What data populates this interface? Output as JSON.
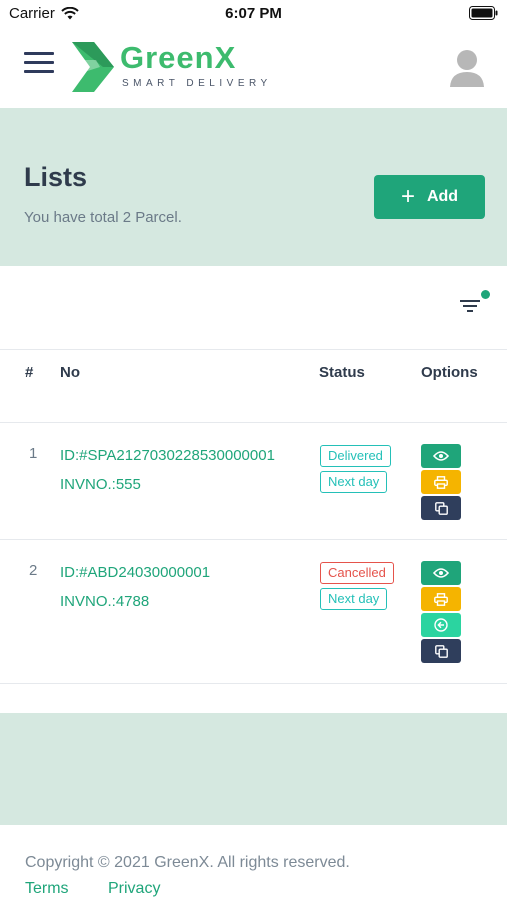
{
  "status_bar": {
    "carrier": "Carrier",
    "time": "6:07 PM"
  },
  "header": {
    "brand": "GreenX",
    "tagline": "SMART DELIVERY",
    "menu_icon": "hamburger-icon",
    "avatar_icon": "user-avatar-icon"
  },
  "hero": {
    "title": "Lists",
    "subtitle": "You have total 2 Parcel.",
    "add_label": "Add"
  },
  "table": {
    "columns": [
      "#",
      "No",
      "Status",
      "Options"
    ],
    "rows": [
      {
        "index": "1",
        "id": "ID:#SPA2127030228530000001",
        "invoice": "INVNO.:555",
        "status": "Delivered",
        "delivery": "Next day",
        "options": [
          "view",
          "print",
          "copy"
        ]
      },
      {
        "index": "2",
        "id": "ID:#ABD24030000001",
        "invoice": "INVNO.:4788",
        "status": "Cancelled",
        "delivery": "Next day",
        "options": [
          "view",
          "print",
          "return",
          "copy"
        ]
      }
    ]
  },
  "footer": {
    "copyright": "Copyright © 2021 GreenX. All rights reserved.",
    "links": [
      "Terms",
      "Privacy"
    ]
  },
  "colors": {
    "brand_green": "#1fa57a",
    "logo_green": "#3dbb6e",
    "band_bg": "#d5e8e0",
    "print_yellow": "#f5b400",
    "copy_navy": "#2f3e5c",
    "cancel_red": "#e5534b",
    "status_teal": "#24c0b8"
  }
}
